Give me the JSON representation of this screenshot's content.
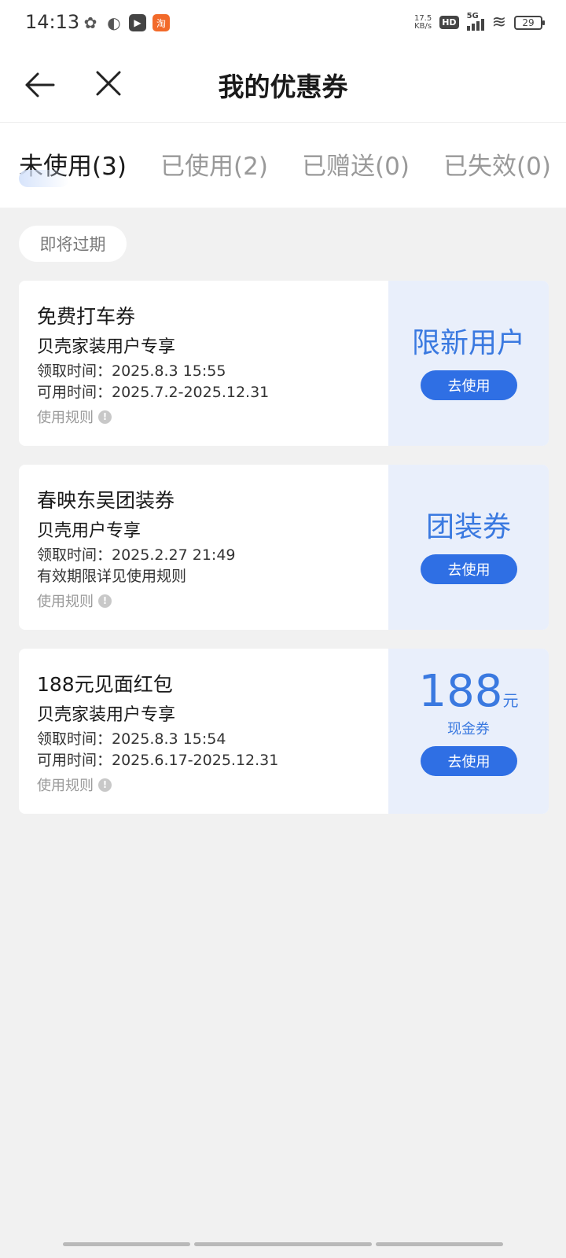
{
  "status_bar": {
    "time": "14:13",
    "net_speed_value": "17.5",
    "net_speed_unit": "KB/s",
    "hd": "HD",
    "network": "5G",
    "battery": "29",
    "taobao_icon_text": "淘"
  },
  "header": {
    "title": "我的优惠券"
  },
  "tabs": [
    {
      "label": "未使用(3)",
      "active": true
    },
    {
      "label": "已使用(2)",
      "active": false
    },
    {
      "label": "已赠送(0)",
      "active": false
    },
    {
      "label": "已失效(0)",
      "active": false
    }
  ],
  "section_chip": "即将过期",
  "coupons": [
    {
      "title": "免费打车券",
      "subtitle": "贝壳家装用户专享",
      "line1": "领取时间：2025.8.3 15:55",
      "line2": "可用时间：2025.7.2-2025.12.31",
      "rules": "使用规则",
      "right_title": "限新用户",
      "button": "去使用"
    },
    {
      "title": "春映东吴团装券",
      "subtitle": "贝壳用户专享",
      "line1": "领取时间：2025.2.27 21:49",
      "line2": "有效期限详见使用规则",
      "rules": "使用规则",
      "right_title": "团装券",
      "button": "去使用"
    },
    {
      "title": "188元见面红包",
      "subtitle": "贝壳家装用户专享",
      "line1": "领取时间：2025.8.3 15:54",
      "line2": "可用时间：2025.6.17-2025.12.31",
      "rules": "使用规则",
      "amount": "188",
      "amount_unit": "元",
      "amount_label": "现金券",
      "button": "去使用"
    }
  ],
  "colors": {
    "accent": "#2f6fe4",
    "accent_text": "#3a79e0",
    "coupon_side_bg": "#e9effb",
    "page_bg": "#f1f1f1"
  }
}
